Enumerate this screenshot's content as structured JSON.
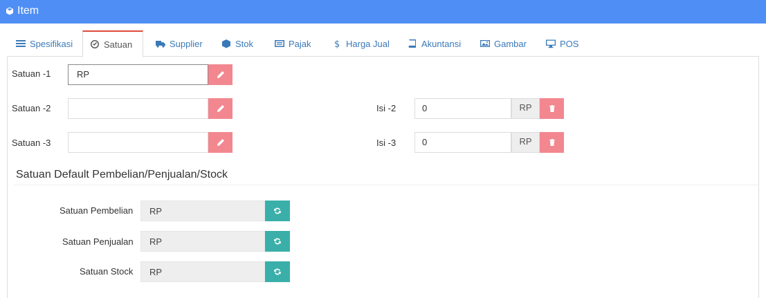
{
  "header": {
    "title": "Item"
  },
  "tabs": [
    {
      "label": "Spesifikasi",
      "icon": "list-icon"
    },
    {
      "label": "Satuan",
      "icon": "check-circle-icon",
      "active": true
    },
    {
      "label": "Supplier",
      "icon": "truck-icon"
    },
    {
      "label": "Stok",
      "icon": "cube-icon"
    },
    {
      "label": "Pajak",
      "icon": "list-alt-icon"
    },
    {
      "label": "Harga Jual",
      "icon": "dollar-icon"
    },
    {
      "label": "Akuntansi",
      "icon": "book-icon"
    },
    {
      "label": "Gambar",
      "icon": "image-icon"
    },
    {
      "label": "POS",
      "icon": "monitor-icon"
    }
  ],
  "satuan": [
    {
      "label": "Satuan -1",
      "value": "RP"
    },
    {
      "label": "Satuan -2",
      "value": "",
      "isi_label": "Isi -2",
      "isi_value": "0",
      "isi_unit": "RP"
    },
    {
      "label": "Satuan -3",
      "value": "",
      "isi_label": "Isi -3",
      "isi_value": "0",
      "isi_unit": "RP"
    }
  ],
  "default_section": {
    "title": "Satuan Default Pembelian/Penjualan/Stock",
    "rows": [
      {
        "label": "Satuan Pembelian",
        "value": "RP"
      },
      {
        "label": "Satuan Penjualan",
        "value": "RP"
      },
      {
        "label": "Satuan Stock",
        "value": "RP"
      }
    ]
  },
  "colors": {
    "header": "#4f8ef5",
    "danger_button": "#f2878f",
    "refresh_button": "#3aafa9",
    "active_tab_border": "#dd4b39",
    "tab_link": "#3a79b8"
  }
}
